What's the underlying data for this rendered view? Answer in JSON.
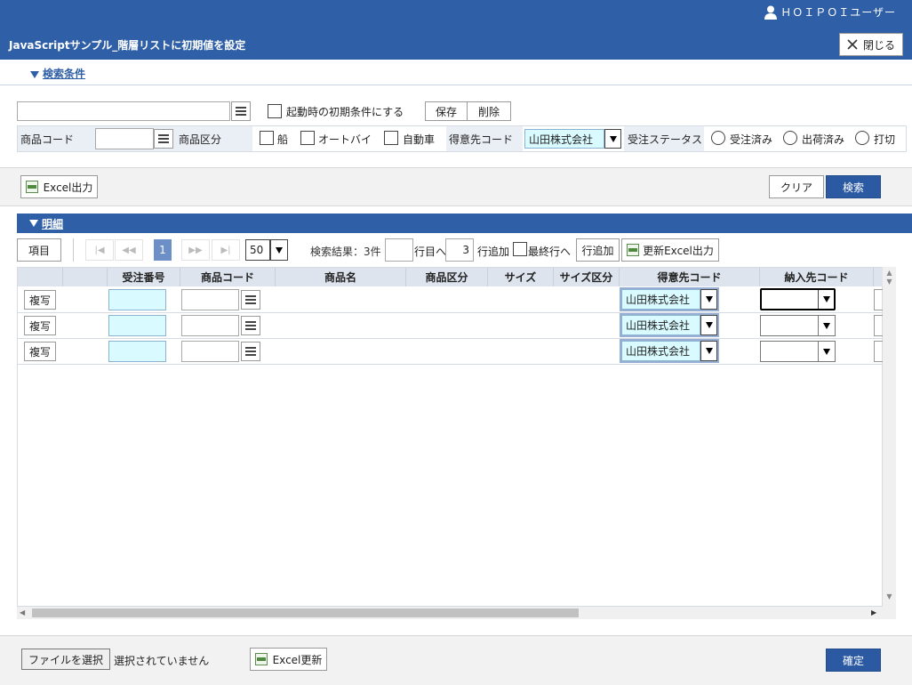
{
  "header": {
    "user": "ＨＯＩＰＯＩユーザー",
    "title": "JavaScriptサンプル_階層リストに初期値を設定",
    "close_label": "閉じる"
  },
  "search": {
    "section_label": "検索条件",
    "startup_label": "起動時の初期条件にする",
    "save_label": "保存",
    "delete_label": "削除",
    "product_code_label": "商品コード",
    "product_category_label": "商品区分",
    "cat_boat": "船",
    "cat_bike": "オートバイ",
    "cat_car": "自動車",
    "customer_code_label": "得意先コード",
    "customer_value": "山田株式会社",
    "order_status_label": "受注ステータス",
    "status_ordered": "受注済み",
    "status_shipped": "出荷済み",
    "status_closed": "打切"
  },
  "actions": {
    "excel_output": "Excel出力",
    "clear": "クリア",
    "search": "検索"
  },
  "detail": {
    "section_label": "明細",
    "columns_button": "項目",
    "page": "1",
    "page_size": "50",
    "result_text": "検索結果：3件",
    "goto_row_label": "行目へ",
    "add_count": "3",
    "add_row_label": "行追加",
    "last_row_label": "最終行へ",
    "add_row_button": "行追加",
    "update_excel_button": "更新Excel出力"
  },
  "table": {
    "headers": [
      "受注番号",
      "商品コード",
      "商品名",
      "商品区分",
      "サイズ",
      "サイズ区分",
      "得意先コード",
      "納入先コード"
    ],
    "copy_label": "複写",
    "customer_value": "山田株式会社"
  },
  "footer": {
    "file_button": "ファイルを選択",
    "file_status": "選択されていません",
    "excel_update": "Excel更新",
    "confirm": "確定"
  }
}
